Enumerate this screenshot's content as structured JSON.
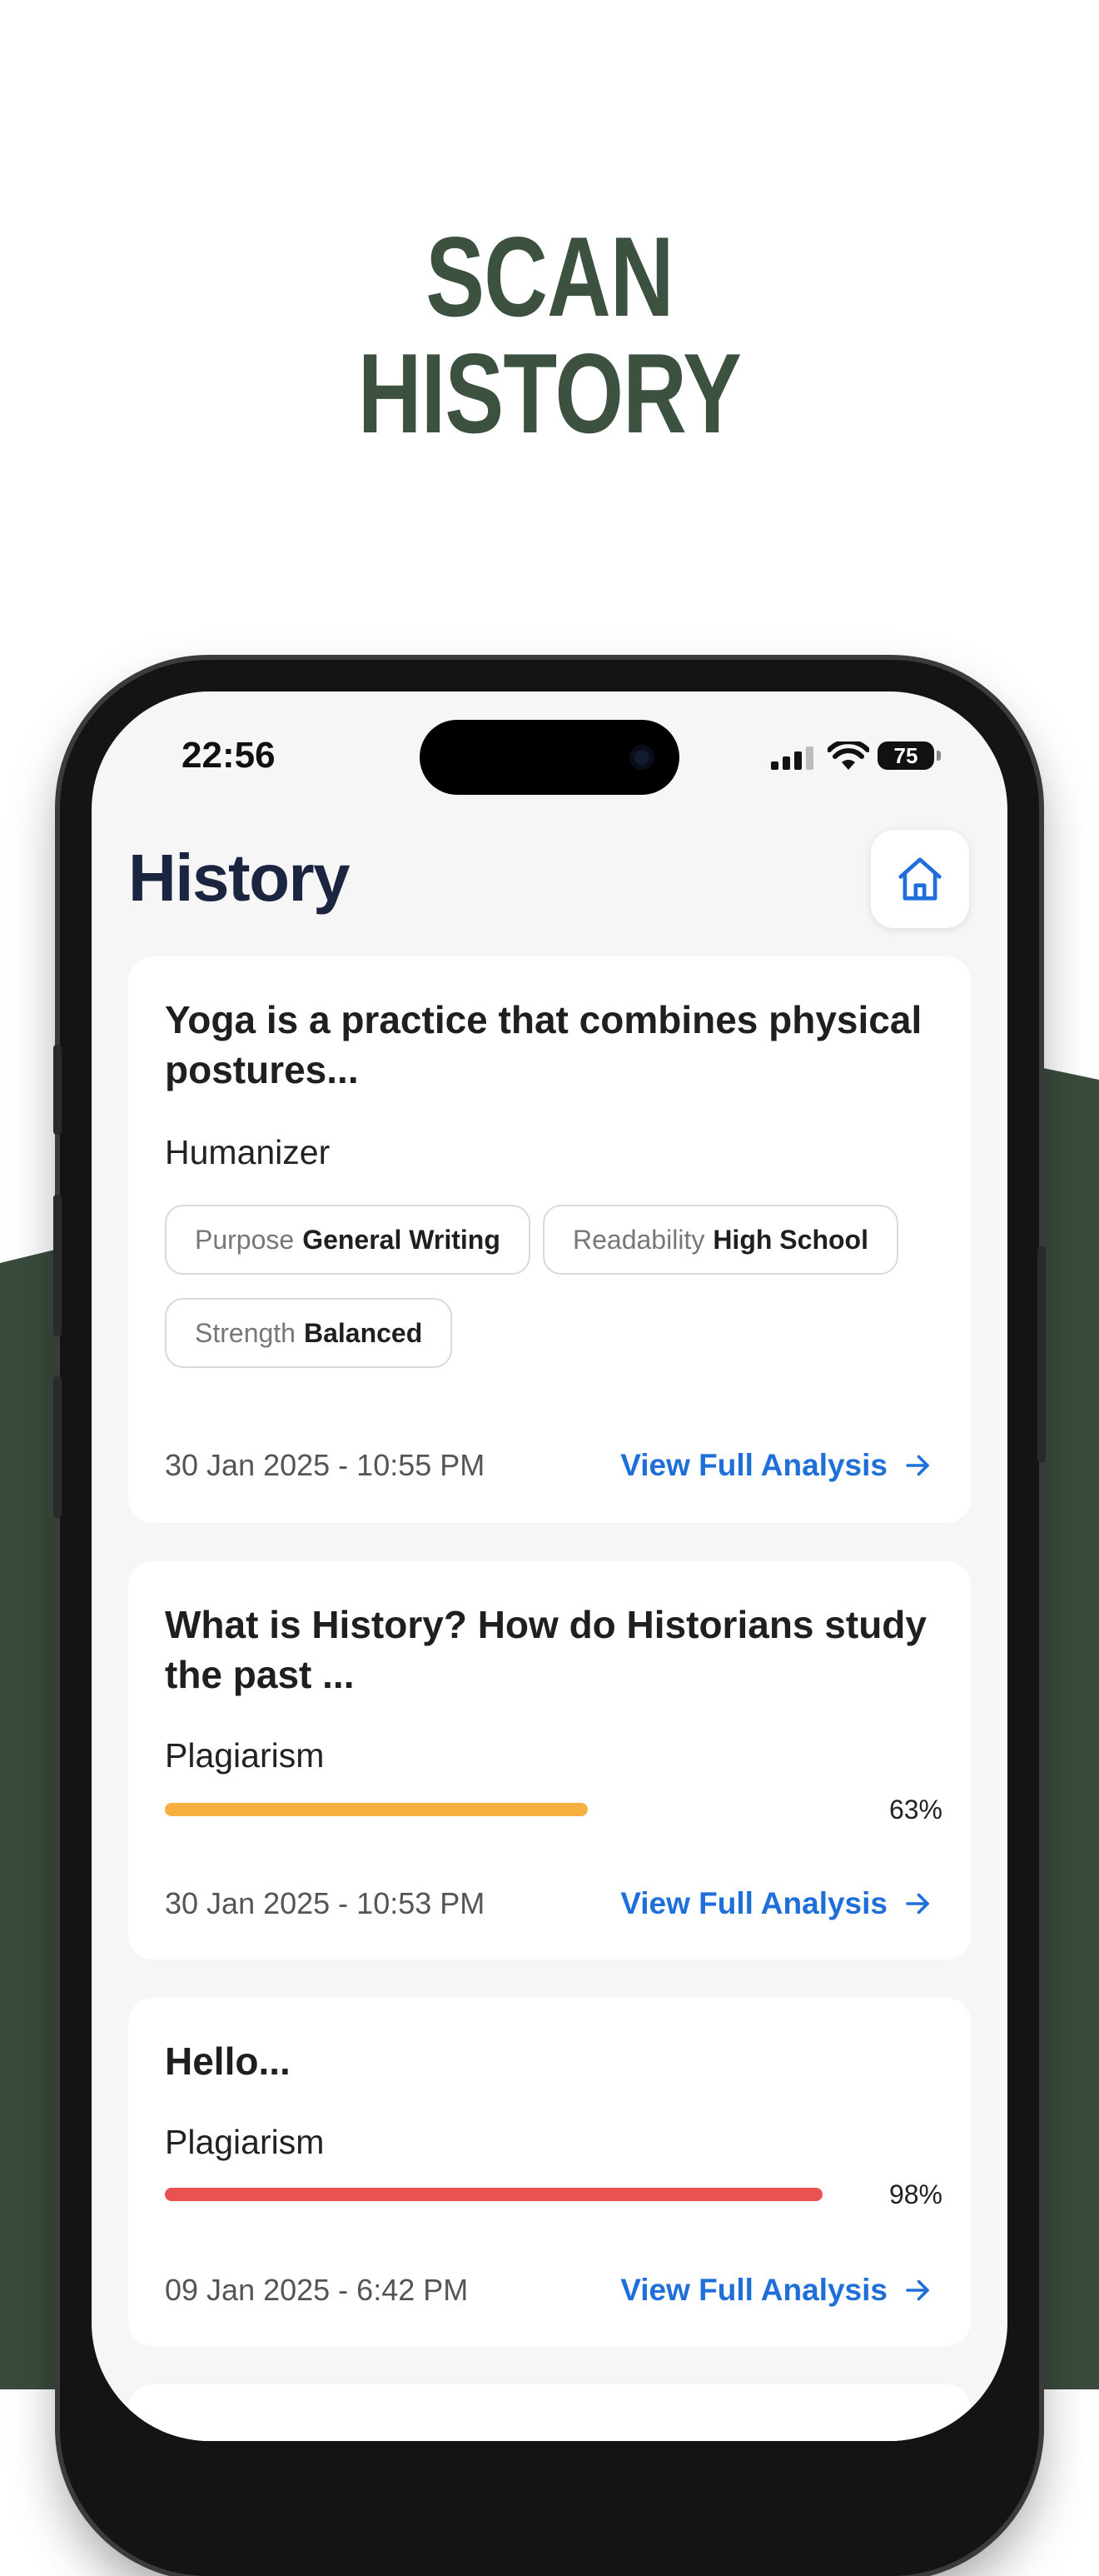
{
  "promo": {
    "line1": "SCAN",
    "line2": "HISTORY"
  },
  "status_bar": {
    "time": "22:56",
    "battery": "75"
  },
  "header": {
    "title": "History"
  },
  "colors": {
    "headline": "#3c5140",
    "background_green": "#3a4b3d",
    "link": "#1e6fd9",
    "progress_medium": "#f5b041",
    "progress_high": "#ea5252"
  },
  "history": [
    {
      "title": "Yoga is a practice that combines physical postures...",
      "type": "Humanizer",
      "chips": [
        {
          "label": "Purpose",
          "value": "General Writing"
        },
        {
          "label": "Readability",
          "value": "High School"
        },
        {
          "label": "Strength",
          "value": "Balanced"
        }
      ],
      "date": "30 Jan 2025 - 10:55 PM",
      "action": "View Full Analysis"
    },
    {
      "title": "What is History? How do Historians study the past ...",
      "type": "Plagiarism",
      "score_label": "63%",
      "score": 0.63,
      "date": "30 Jan 2025 - 10:53 PM",
      "action": "View Full Analysis"
    },
    {
      "title": "Hello...",
      "type": "Plagiarism",
      "score_label": "98%",
      "score": 0.98,
      "date": "09 Jan 2025 - 6:42 PM",
      "action": "View Full Analysis"
    }
  ]
}
